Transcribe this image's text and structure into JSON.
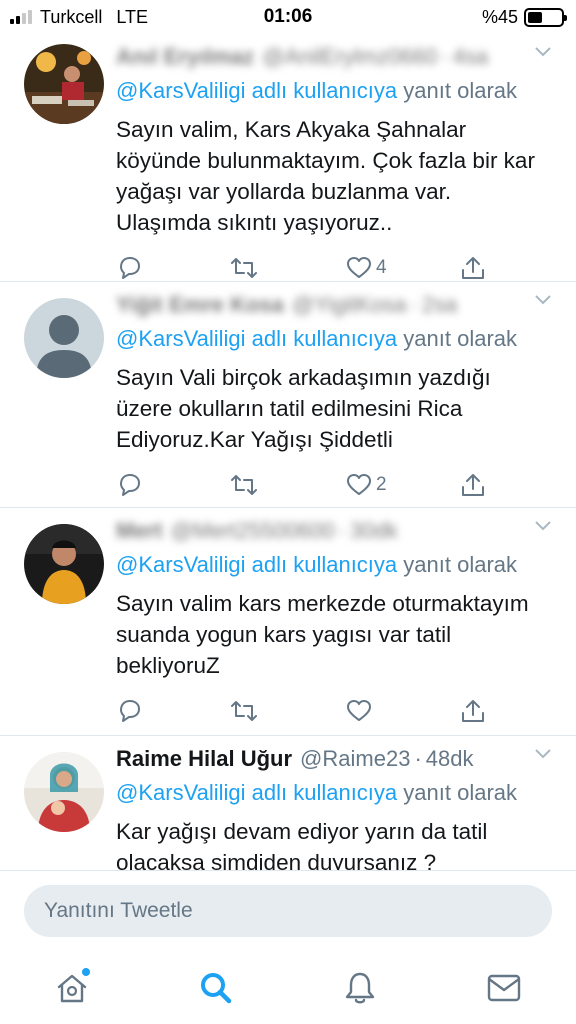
{
  "status_bar": {
    "carrier": "Turkcell",
    "network": "LTE",
    "time": "01:06",
    "battery_text": "%45",
    "battery_level": 0.45
  },
  "tweets": [
    {
      "name": "Anıl Eryılmaz",
      "handle": "@AnilErylmz0660",
      "time": "4sa",
      "blurred": true,
      "reply_mention": "@KarsValiligi adlı kullanıcıya",
      "reply_suffix": "yanıt olarak",
      "text": "Sayın valim, Kars Akyaka Şahnalar köyünde bulunmaktayım. Çok fazla bir kar yağaşı var yollarda buzlanma var. Ulaşımda sıkıntı yaşıyoruz..",
      "likes": "4"
    },
    {
      "name": "Yiğit Emre Kosa",
      "handle": "@YigitKosa",
      "time": "2sa",
      "blurred": true,
      "reply_mention": "@KarsValiligi adlı kullanıcıya",
      "reply_suffix": "yanıt olarak",
      "text": "Sayın Vali birçok arkadaşımın yazdığı üzere okulların tatil edilmesini Rica Ediyoruz.Kar Yağışı Şiddetli",
      "likes": "2"
    },
    {
      "name": "Mert",
      "handle": "@Mert25500600",
      "time": "30dk",
      "blurred": true,
      "reply_mention": "@KarsValiligi adlı kullanıcıya",
      "reply_suffix": "yanıt olarak",
      "text": "Sayın valim kars merkezde oturmaktayım suanda yogun kars yagısı var tatil bekliyoruZ",
      "likes": ""
    },
    {
      "name": "Raime Hilal Uğur",
      "handle": "@Raime23",
      "time": "48dk",
      "blurred": false,
      "reply_mention": "@KarsValiligi adlı kullanıcıya",
      "reply_suffix": "yanıt olarak",
      "text": "Kar yağışı devam ediyor yarın da tatil olacaksa şimdiden duyursanız ?",
      "likes": ""
    }
  ],
  "reply_bar": {
    "placeholder": "Yanıtını Tweetle"
  },
  "tab_bar": {
    "icons": [
      "home-icon",
      "search-icon",
      "notifications-icon",
      "messages-icon"
    ]
  },
  "colors": {
    "accent": "#1da1f2",
    "secondary_text": "#657786",
    "divider": "#e1e8ed"
  }
}
